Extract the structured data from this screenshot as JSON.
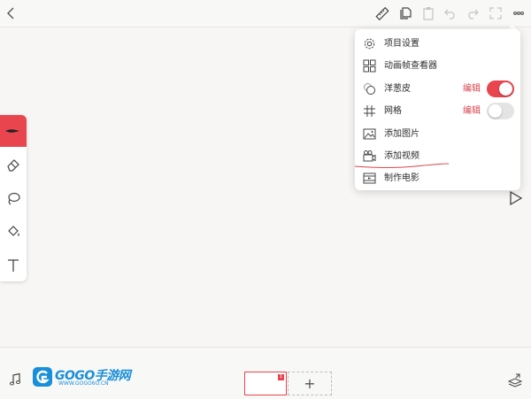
{
  "colors": {
    "accent": "#e8454f",
    "edit_text": "#d9434d",
    "logo_blue": "#1a8fd9"
  },
  "topbar": {
    "icons": [
      "back-icon",
      "ruler-icon",
      "duplicate-icon",
      "paste-icon",
      "undo-icon",
      "redo-icon",
      "fullscreen-icon",
      "more-icon"
    ]
  },
  "menu": {
    "items": [
      {
        "icon": "gear-icon",
        "label": "项目设置"
      },
      {
        "icon": "grid-view-icon",
        "label": "动画帧查看器"
      },
      {
        "icon": "onion-skin-icon",
        "label": "洋葱皮",
        "edit": "编辑",
        "toggle": "on"
      },
      {
        "icon": "grid-icon",
        "label": "网格",
        "edit": "编辑",
        "toggle": "off"
      },
      {
        "icon": "image-icon",
        "label": "添加图片"
      },
      {
        "icon": "video-icon",
        "label": "添加视频"
      },
      {
        "icon": "movie-icon",
        "label": "制作电影"
      }
    ]
  },
  "tools": [
    "brush-icon",
    "eraser-icon",
    "lasso-icon",
    "fill-bucket-icon",
    "text-icon"
  ],
  "bottombar": {
    "logo_text": "GOGO手游网",
    "logo_sub": "WWW.GOGO6O.CN",
    "frame_number": "1",
    "add_label": "+"
  }
}
